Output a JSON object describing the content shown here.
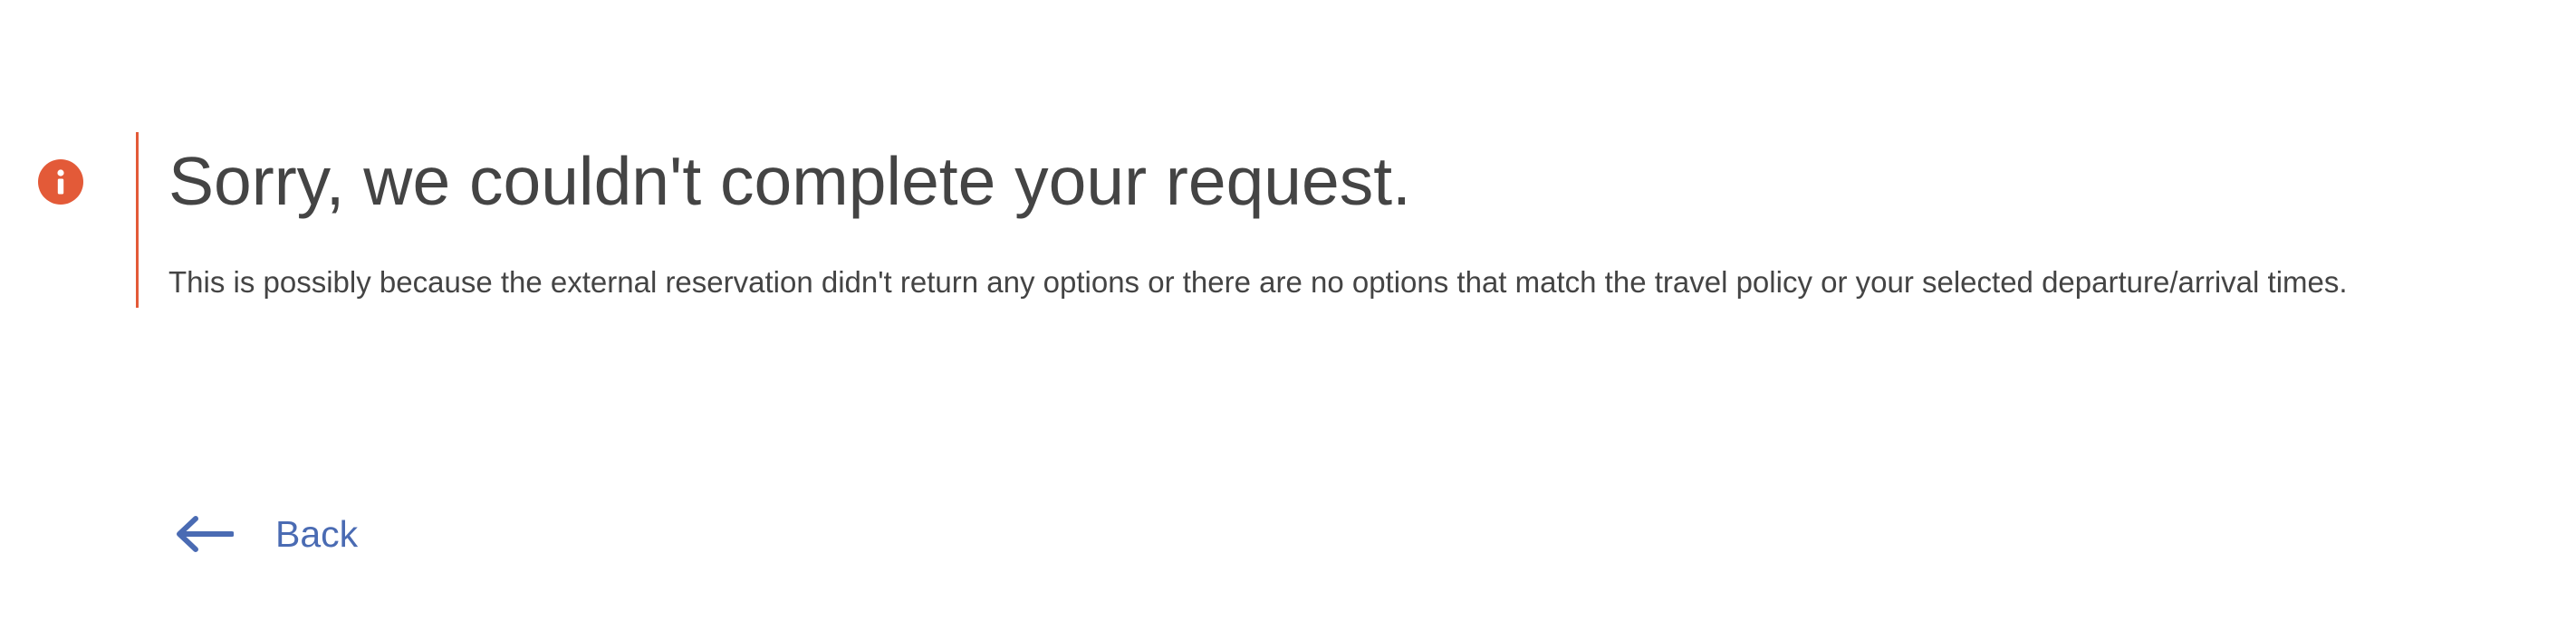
{
  "icons": {
    "error": "info-circle-icon",
    "back": "arrow-left-icon"
  },
  "colors": {
    "error_accent": "#e35a38",
    "link": "#4a6bb3",
    "text": "#444444"
  },
  "error": {
    "title": "Sorry, we couldn't complete your request.",
    "description": "This is possibly because the external reservation didn't return any options or there are no options that match the travel policy or your selected departure/arrival times."
  },
  "back": {
    "label": "Back"
  }
}
